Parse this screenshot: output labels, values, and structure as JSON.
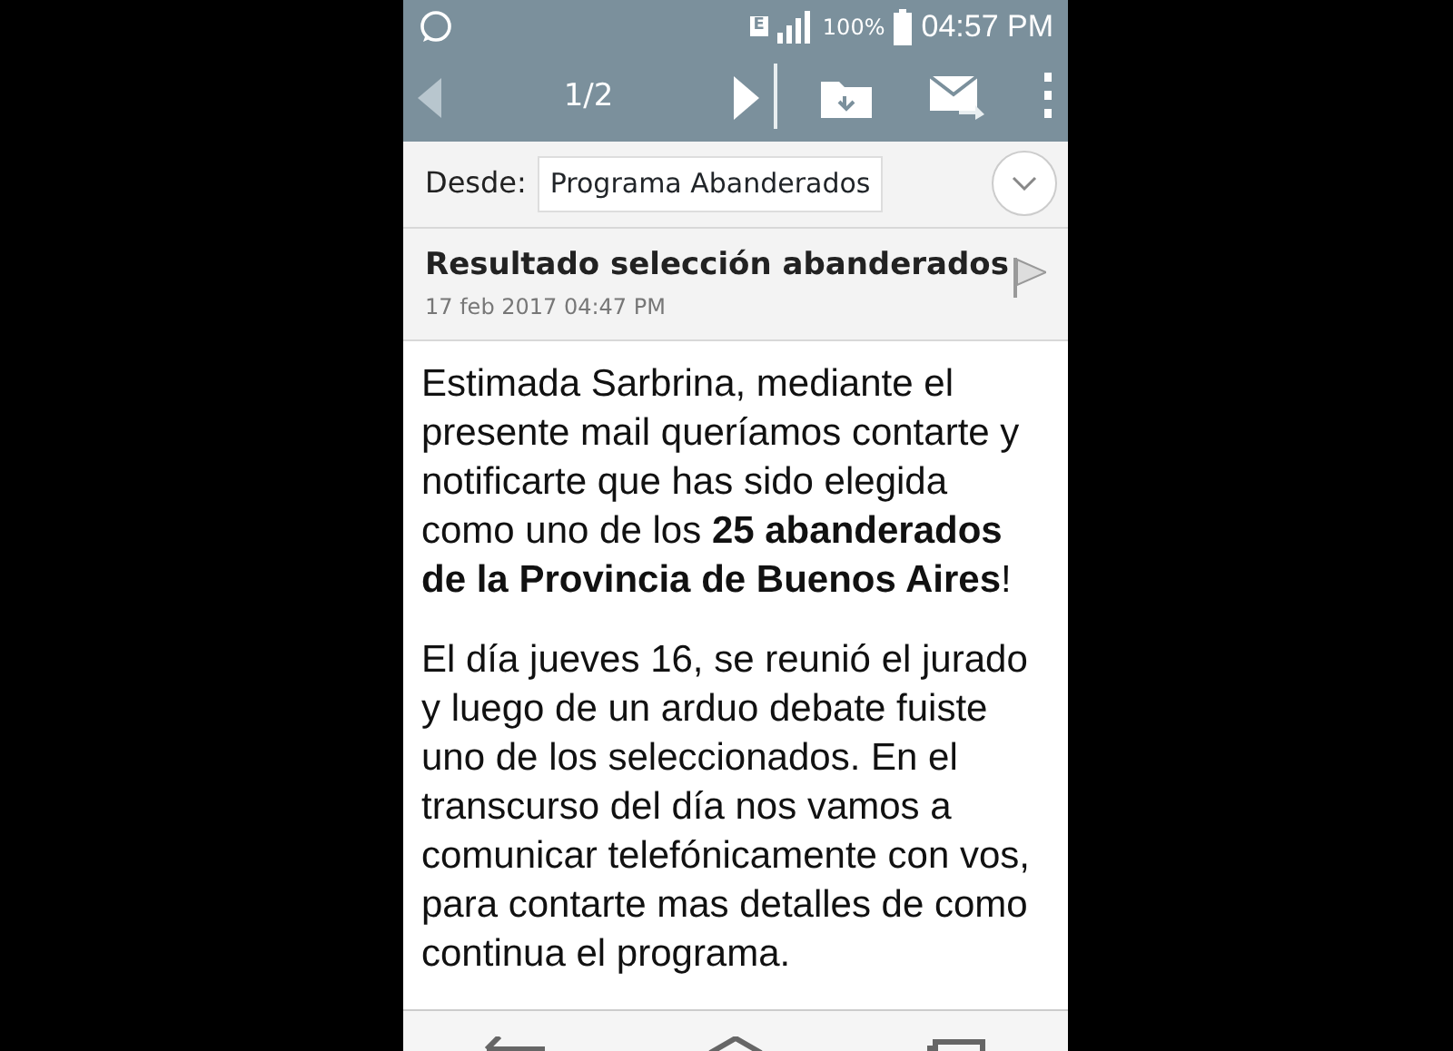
{
  "status_bar": {
    "network": "E",
    "battery": "100%",
    "time": "04:57 PM"
  },
  "toolbar": {
    "counter": "1/2"
  },
  "sender": {
    "label": "Desde:",
    "value": "Programa Abanderados"
  },
  "message": {
    "subject": "Resultado selección abanderados",
    "date": "17 feb 2017 04:47 PM",
    "flagged": false,
    "paragraphs": [
      "Estimada Sarbrina, mediante el presente mail queríamos contarte y notificarte que has sido elegida como uno de los **25 abanderados de la Provincia de Buenos Aires**!",
      "El día jueves 16, se reunió el jurado y luego de un arduo debate fuiste uno de los seleccionados. En el transcurso del día nos vamos a comunicar telefónicamente con vos, para contarte mas detalles de como continua el programa."
    ]
  }
}
